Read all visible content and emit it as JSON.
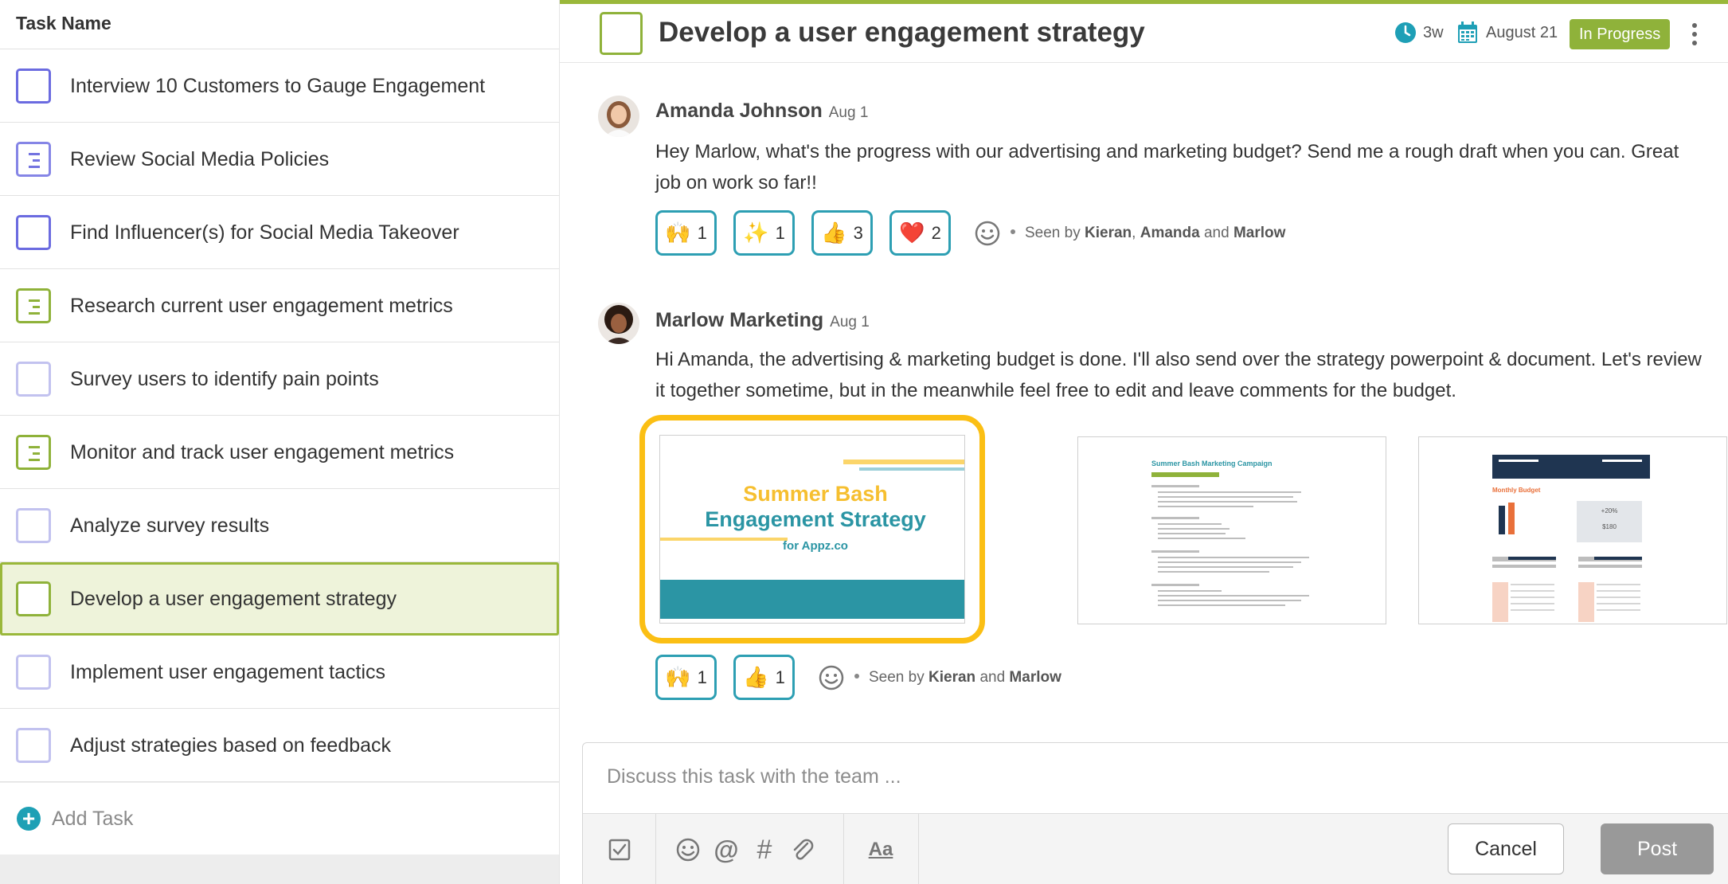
{
  "task_list": {
    "header": "Task Name",
    "tasks": [
      {
        "name": "Interview 10 Customers to Gauge Engagement",
        "icon": "checkbox-icon"
      },
      {
        "name": "Review Social Media Policies",
        "icon": "list-checkbox-icon"
      },
      {
        "name": "Find Influencer(s) for Social Media Takeover",
        "icon": "checkbox-icon"
      },
      {
        "name": "Research current user engagement metrics",
        "icon": "list-checkbox-icon"
      },
      {
        "name": "Survey users to identify pain points",
        "icon": "checkbox-icon"
      },
      {
        "name": "Monitor and track user engagement metrics",
        "icon": "list-checkbox-icon"
      },
      {
        "name": "Analyze survey results",
        "icon": "checkbox-icon"
      },
      {
        "name": "Develop a user engagement strategy",
        "icon": "checkbox-icon",
        "selected": true
      },
      {
        "name": "Implement user engagement tactics",
        "icon": "checkbox-icon"
      },
      {
        "name": "Adjust strategies based on feedback",
        "icon": "checkbox-icon"
      }
    ],
    "add_task": "Add Task"
  },
  "detail": {
    "title": "Develop a user engagement strategy",
    "duration": "3w",
    "due_date": "August 21",
    "status": "In Progress",
    "accent_color": "#8fb23a",
    "status_color": "#8fb23a"
  },
  "comments": [
    {
      "author": "Amanda Johnson",
      "date": "Aug 1",
      "text": "Hey Marlow, what's the progress with our advertising and marketing budget? Send me a rough draft when you can. Great job on work so far!!",
      "reactions": [
        {
          "emoji": "🙌",
          "count": "1"
        },
        {
          "emoji": "✨",
          "count": "1"
        },
        {
          "emoji": "👍",
          "count": "3"
        },
        {
          "emoji": "❤️",
          "count": "2"
        }
      ],
      "seen_prefix": "Seen by",
      "seen_names": [
        "Kieran",
        "Amanda",
        "Marlow"
      ],
      "seen_sep": ",",
      "seen_and": "and"
    },
    {
      "author": "Marlow Marketing",
      "date": "Aug 1",
      "text": "Hi Amanda, the advertising & marketing budget is done. I'll also send over the strategy powerpoint & document. Let's review it together sometime, but in the meanwhile feel free to edit and leave comments for the budget.",
      "attachments": {
        "slide": {
          "line1": "Summer Bash",
          "line2": "Engagement Strategy",
          "line3": "for Appz.co"
        },
        "doc": {
          "title": "Summer Bash Marketing Campaign"
        },
        "sheet": {
          "title": "Monthly Budget",
          "kpi1": "+20%",
          "kpi2": "$180"
        }
      },
      "reactions": [
        {
          "emoji": "🙌",
          "count": "1"
        },
        {
          "emoji": "👍",
          "count": "1"
        }
      ],
      "seen_prefix": "Seen by",
      "seen_names": [
        "Kieran",
        "Marlow"
      ],
      "seen_and": "and"
    }
  ],
  "composer": {
    "placeholder": "Discuss this task with the team ...",
    "cancel": "Cancel",
    "post": "Post",
    "text_format_glyph": "Aa"
  }
}
